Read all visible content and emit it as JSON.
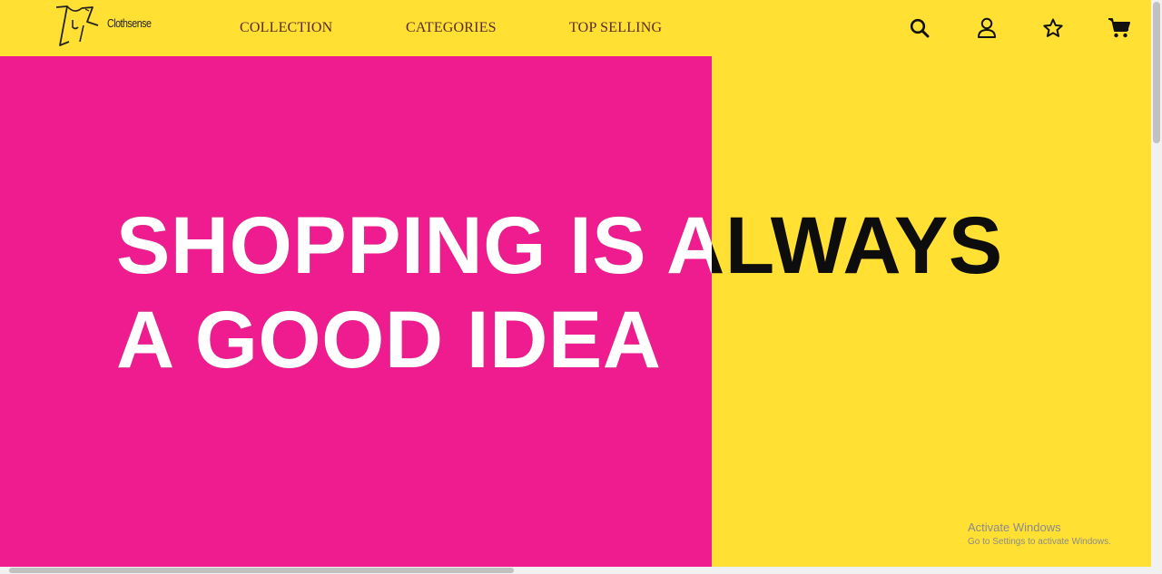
{
  "brand": {
    "name": "Clothsense"
  },
  "nav": {
    "collection": "COLLECTION",
    "categories": "CATEGORIES",
    "top_selling": "TOP SELLING"
  },
  "icons": {
    "search": "search-icon",
    "account": "user-icon",
    "wishlist": "star-icon",
    "cart": "cart-icon"
  },
  "hero": {
    "line1": "SHOPPING IS ALWAYS",
    "line2": "A GOOD IDEA"
  },
  "watermark": {
    "title": "Activate Windows",
    "subtitle": "Go to Settings to activate Windows."
  },
  "colors": {
    "background_yellow": "#ffe033",
    "accent_pink": "#ee1c8e",
    "headline_dark": "#0d0d0d",
    "headline_light": "#ffffff"
  }
}
